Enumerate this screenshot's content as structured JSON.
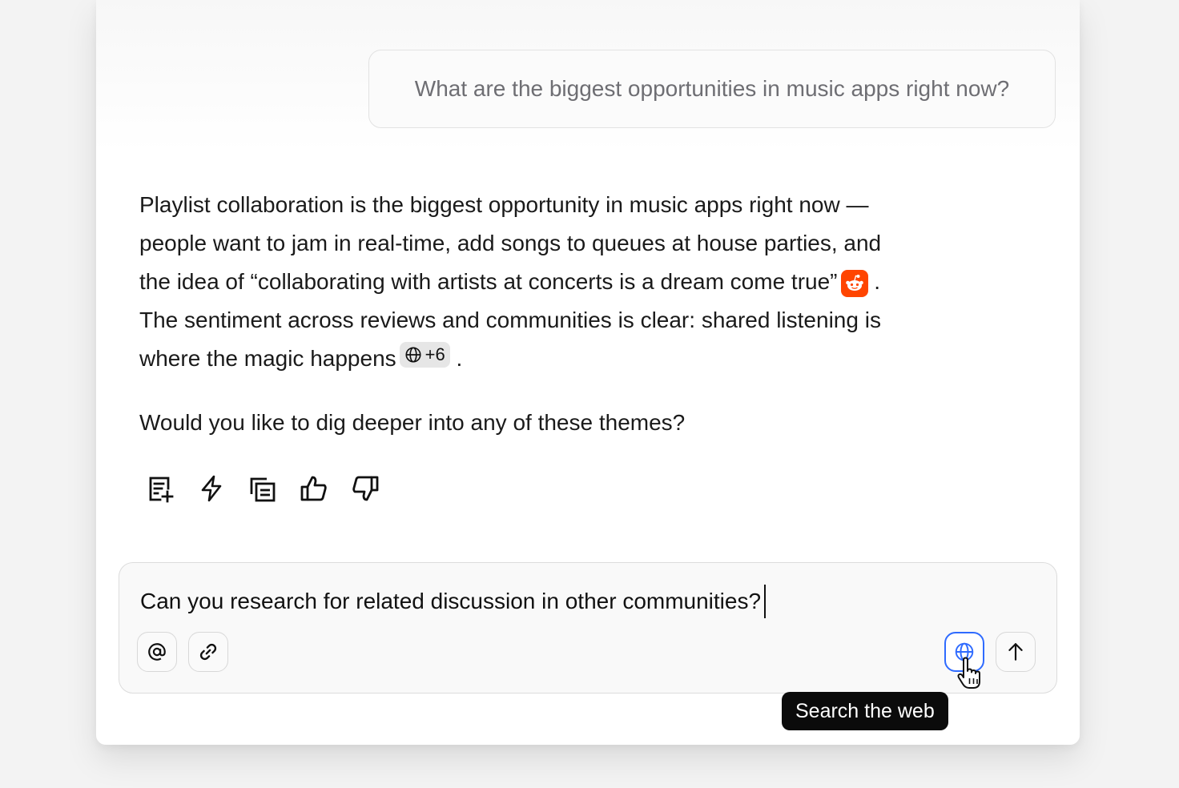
{
  "conversation": {
    "user_message": "What are the biggest opportunities in music apps right now?",
    "answer": {
      "line1": "Playlist collaboration is the biggest opportunity in music apps right now —",
      "line2": "people want to jam in real-time, add songs to queues at house parties, and",
      "line3": "the idea of “collaborating with artists at concerts is a dream come true”",
      "line3_end": ".",
      "line4": "The sentiment across reviews and communities is clear: shared listening is",
      "line5": "where the magic happens",
      "source_count": "+6",
      "line5_end": ".",
      "followup": "Would you like to dig deeper into any of these themes?"
    },
    "actions": [
      "add-to-notes-icon",
      "lightning-icon",
      "copy-icon",
      "thumbs-up-icon",
      "thumbs-down-icon"
    ]
  },
  "composer": {
    "value": "Can you research for related discussion in other communities?",
    "buttons": [
      "mention-icon",
      "attach-icon",
      "globe-icon",
      "send-icon"
    ],
    "tooltip": "Search the web"
  },
  "colors": {
    "accent": "#2f6bff",
    "reddit": "#ff4500",
    "tooltip_bg": "#0b0b0b"
  }
}
